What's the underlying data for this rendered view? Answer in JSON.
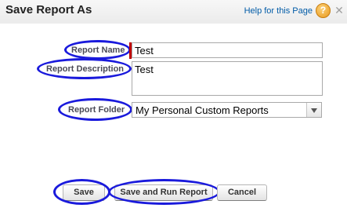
{
  "dialog": {
    "title": "Save Report As",
    "help_link": "Help for this Page",
    "help_icon_glyph": "?",
    "close_glyph": "✕"
  },
  "form": {
    "name_label": "Report Name",
    "name_value": "Test",
    "description_label": "Report Description",
    "description_value": "Test",
    "folder_label": "Report Folder",
    "folder_value": "My Personal Custom Reports"
  },
  "buttons": {
    "save": "Save",
    "save_and_run": "Save and Run Report",
    "cancel": "Cancel"
  },
  "colors": {
    "highlight": "#1a1adc",
    "required": "#c00000",
    "help_link": "#015ba7",
    "help_icon": "#e8981c"
  },
  "icons": {
    "help": "help-question-icon",
    "close": "close-icon",
    "dropdown": "chevron-down-icon"
  }
}
